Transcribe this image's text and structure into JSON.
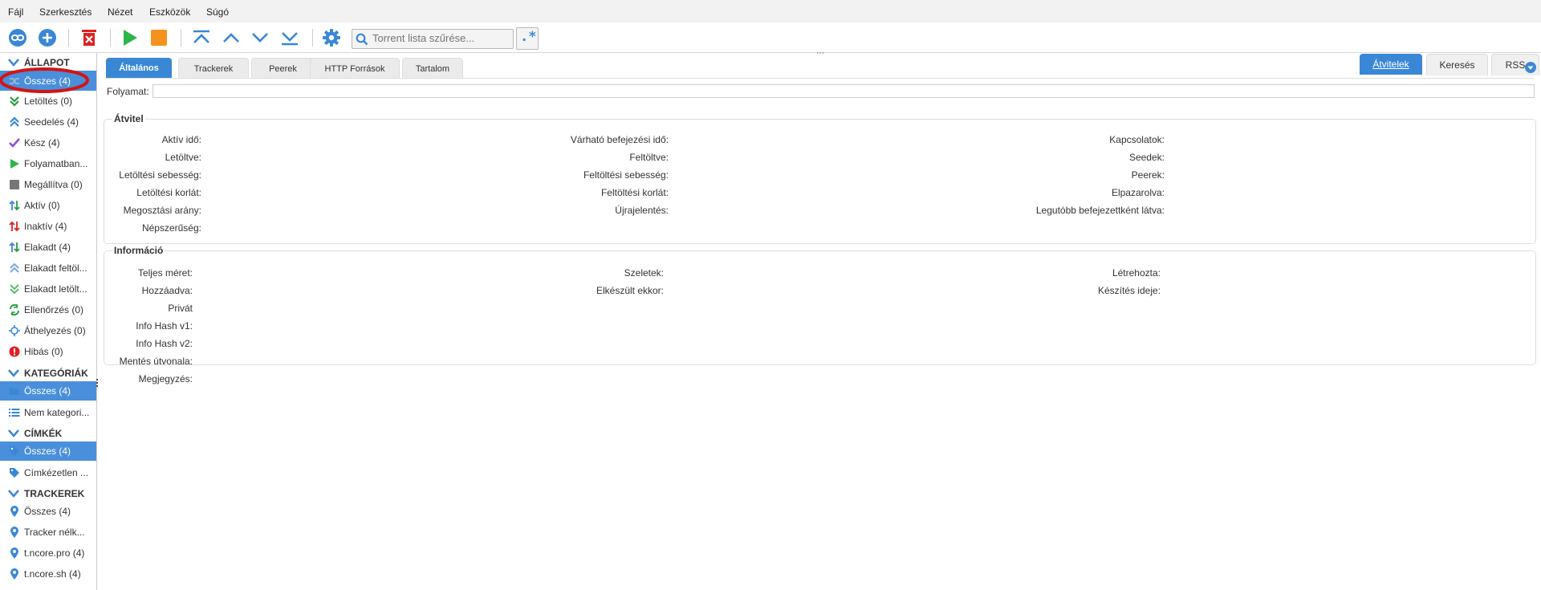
{
  "menu": [
    "Fájl",
    "Szerkesztés",
    "Nézet",
    "Eszközök",
    "Súgó"
  ],
  "toolbar": {
    "filter_placeholder": "Torrent lista szűrése...",
    "regex_label": ".*",
    "right_tabs": [
      "Átvitelek",
      "Keresés",
      "RSS"
    ]
  },
  "colors": {
    "accent": "#3a87d6",
    "selection": "#4a8fdb",
    "green": "#2db54a",
    "orange": "#f5921e",
    "red": "#e02020",
    "purple": "#8a4fd8",
    "highlight_circle": "#d41414"
  },
  "sidebar": {
    "sections": [
      {
        "title": "ÁLLAPOT",
        "items": [
          {
            "label": "Összes (4)",
            "icon": "shuffle-icon",
            "selected": true
          },
          {
            "label": "Letöltés (0)",
            "icon": "download-chevron-icon"
          },
          {
            "label": "Seedelés (4)",
            "icon": "upload-chevron-icon"
          },
          {
            "label": "Kész (4)",
            "icon": "check-icon"
          },
          {
            "label": "Folyamatban...",
            "icon": "play-icon"
          },
          {
            "label": "Megállítva (0)",
            "icon": "stop-icon"
          },
          {
            "label": "Aktív (0)",
            "icon": "transfer-active-icon"
          },
          {
            "label": "Inaktív (4)",
            "icon": "transfer-inactive-icon"
          },
          {
            "label": "Elakadt (4)",
            "icon": "transfer-stalled-icon"
          },
          {
            "label": "Elakadt feltöl...",
            "icon": "stalled-upload-icon"
          },
          {
            "label": "Elakadt letölt...",
            "icon": "stalled-download-icon"
          },
          {
            "label": "Ellenőrzés (0)",
            "icon": "checking-icon"
          },
          {
            "label": "Áthelyezés (0)",
            "icon": "moving-icon"
          },
          {
            "label": "Hibás (0)",
            "icon": "error-icon"
          }
        ]
      },
      {
        "title": "KATEGÓRIÁK",
        "items": [
          {
            "label": "Összes (4)",
            "icon": "folder-icon",
            "selected": true
          },
          {
            "label": "Nem kategori...",
            "icon": "list-icon"
          }
        ]
      },
      {
        "title": "CÍMKÉK",
        "items": [
          {
            "label": "Összes (4)",
            "icon": "tag-icon",
            "selected": true
          },
          {
            "label": "Címkézetlen ...",
            "icon": "tag-icon"
          }
        ]
      },
      {
        "title": "TRACKEREK",
        "items": [
          {
            "label": "Összes (4)",
            "icon": "location-pin-icon"
          },
          {
            "label": "Tracker nélk...",
            "icon": "location-pin-icon"
          },
          {
            "label": "t.ncore.pro (4)",
            "icon": "location-pin-icon"
          },
          {
            "label": "t.ncore.sh (4)",
            "icon": "location-pin-icon"
          }
        ]
      }
    ]
  },
  "properties": {
    "tabs": [
      "Általános",
      "Trackerek",
      "Peerek",
      "HTTP Források",
      "Tartalom"
    ],
    "progress_label": "Folyamat:",
    "progress": 0,
    "transfer": {
      "title": "Átvitel",
      "col1": [
        "Aktív idő:",
        "Letöltve:",
        "Letöltési sebesség:",
        "Letöltési korlát:",
        "Megosztási arány:",
        "Népszerűség:"
      ],
      "col2": [
        "Várható befejezési idő:",
        "Feltöltve:",
        "Feltöltési sebesség:",
        "Feltöltési korlát:",
        "Újrajelentés:"
      ],
      "col3": [
        "Kapcsolatok:",
        "Seedek:",
        "Peerek:",
        "Elpazarolva:",
        "Legutóbb befejezettként látva:"
      ]
    },
    "info": {
      "title": "Információ",
      "col1": [
        "Teljes méret:",
        "Hozzáadva:",
        "Privát",
        "Info Hash v1:",
        "Info Hash v2:",
        "Mentés útvonala:",
        "Megjegyzés:"
      ],
      "col2": [
        "Szeletek:",
        "Elkészült ekkor:"
      ],
      "col3": [
        "Létrehozta:",
        "Készítés ideje:"
      ]
    }
  }
}
